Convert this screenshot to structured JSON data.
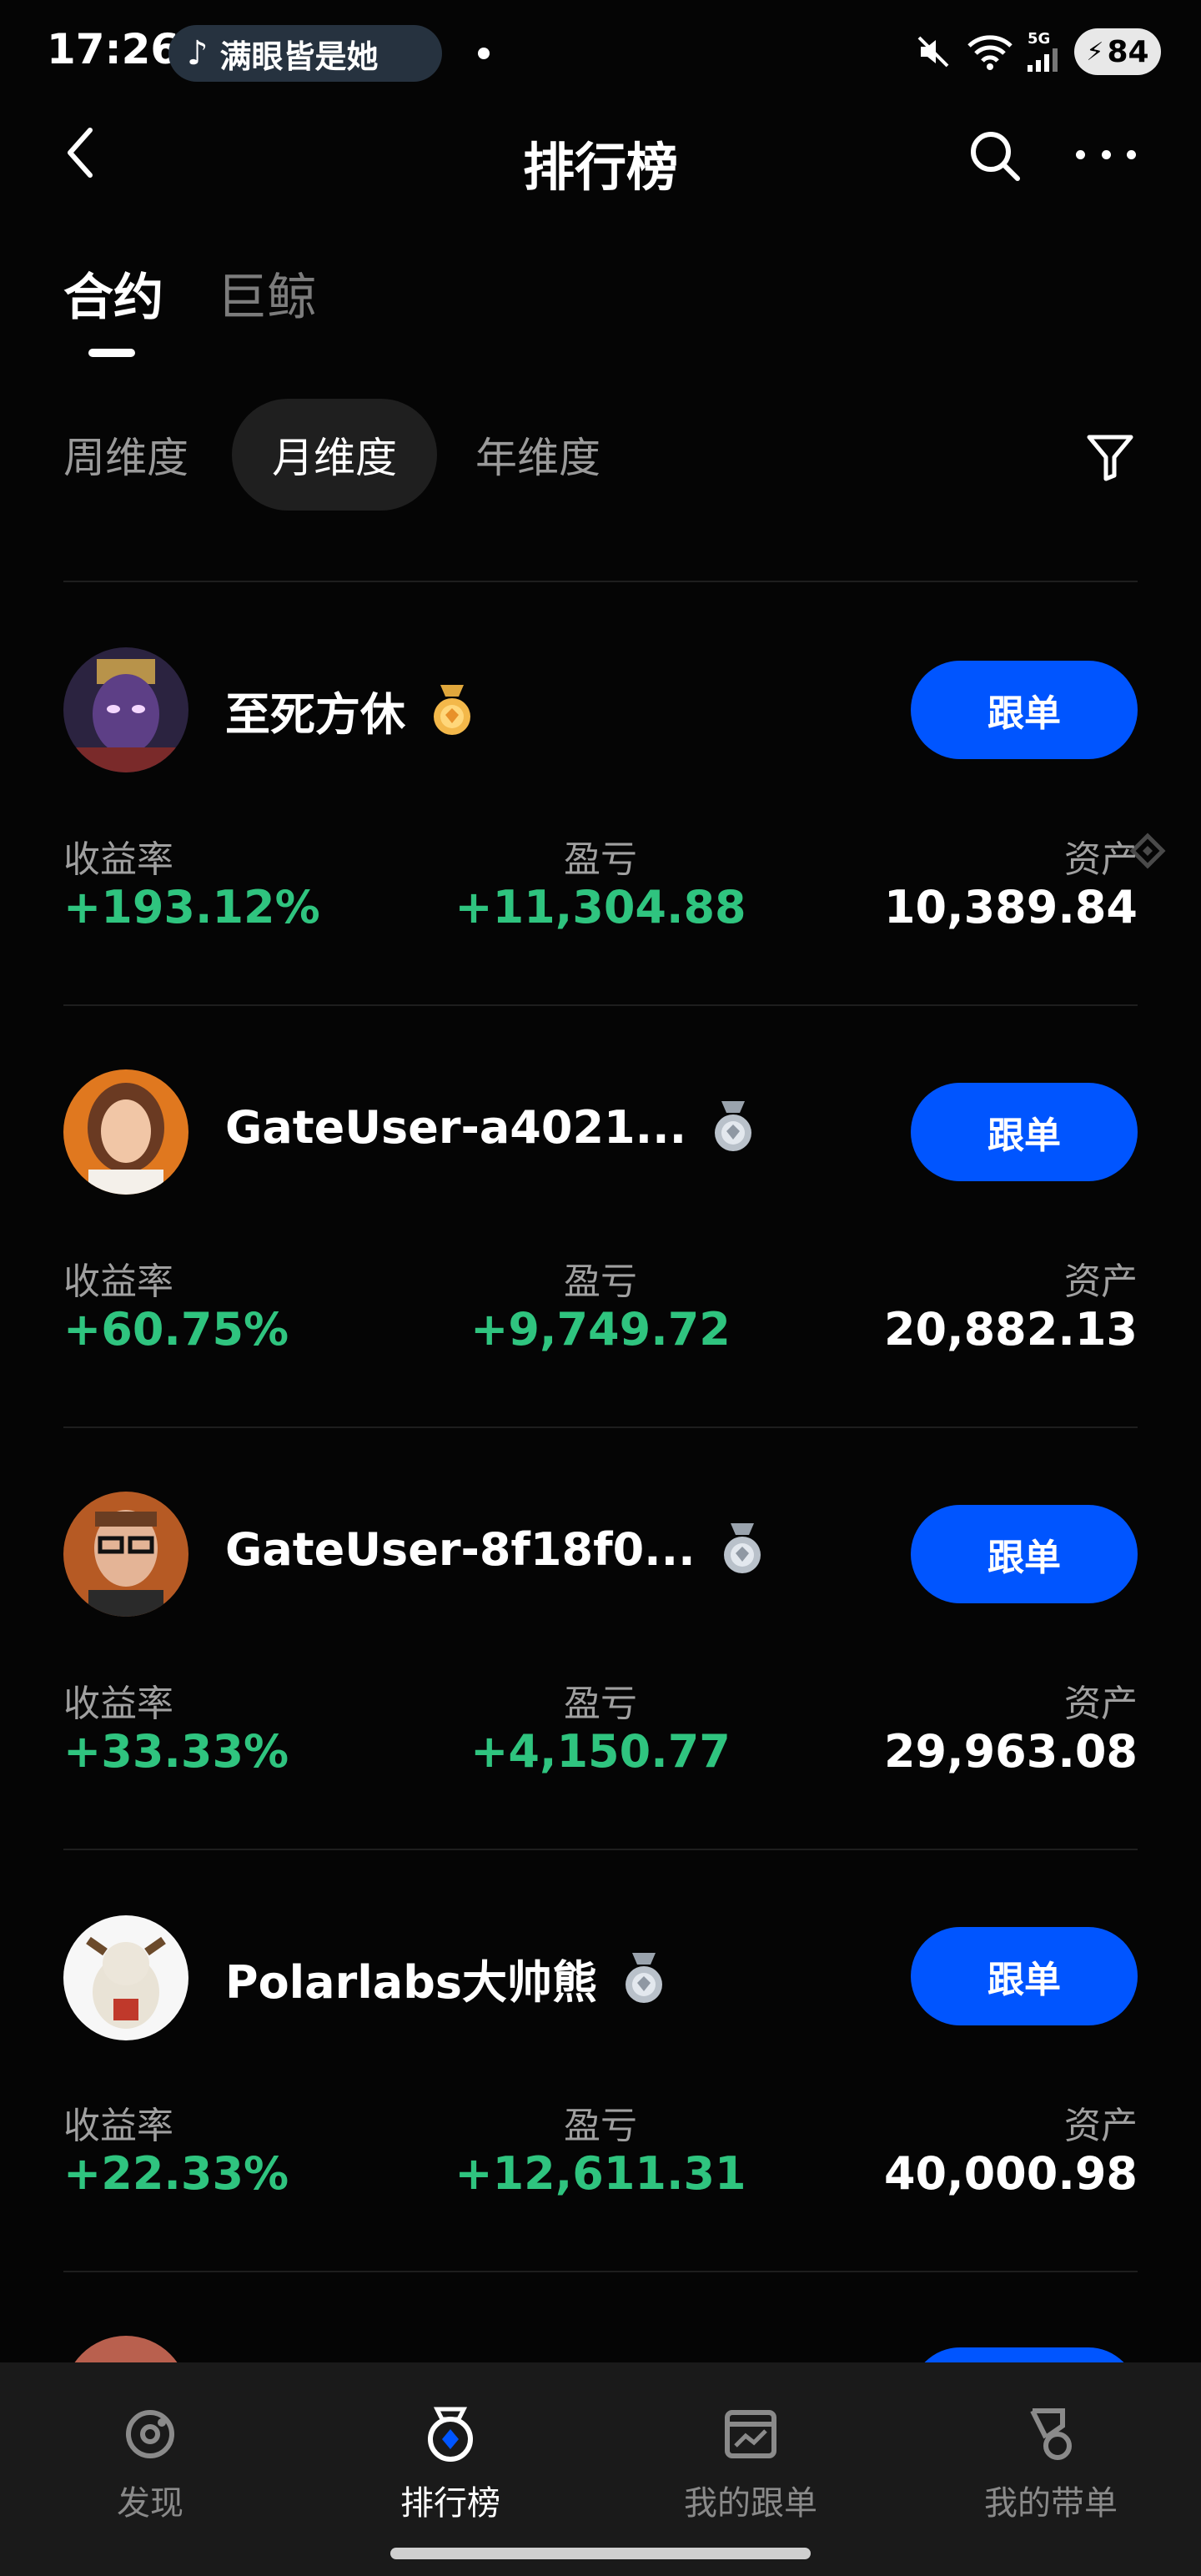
{
  "status_bar": {
    "time": "17:26",
    "tiktok_text": "满眼皆是她",
    "network": "5G",
    "battery": "84"
  },
  "header": {
    "title": "排行榜"
  },
  "main_tabs": [
    {
      "label": "合约",
      "active": true
    },
    {
      "label": "巨鲸",
      "active": false
    }
  ],
  "period_tabs": [
    {
      "label": "周维度",
      "active": false
    },
    {
      "label": "月维度",
      "active": true
    },
    {
      "label": "年维度",
      "active": false
    }
  ],
  "stat_labels": {
    "roi": "收益率",
    "pnl": "盈亏",
    "assets": "资产"
  },
  "follow_label": "跟单",
  "traders": [
    {
      "name": "至死方休",
      "roi": "+193.12%",
      "pnl": "+11,304.88",
      "assets": "10,389.84",
      "medal": "gold-medal-icon"
    },
    {
      "name": "GateUser-a4021...",
      "roi": "+60.75%",
      "pnl": "+9,749.72",
      "assets": "20,882.13",
      "medal": "silver-medal-icon"
    },
    {
      "name": "GateUser-8f18f0...",
      "roi": "+33.33%",
      "pnl": "+4,150.77",
      "assets": "29,963.08",
      "medal": "silver-medal-icon"
    },
    {
      "name": "Polarlabs大帅熊",
      "roi": "+22.33%",
      "pnl": "+12,611.31",
      "assets": "40,000.98",
      "medal": "silver-medal-icon"
    }
  ],
  "bottom_nav": [
    {
      "label": "发现",
      "icon": "discover-icon",
      "active": false
    },
    {
      "label": "排行榜",
      "icon": "leaderboard-icon",
      "active": true
    },
    {
      "label": "我的跟单",
      "icon": "my-copy-trades-icon",
      "active": false
    },
    {
      "label": "我的带单",
      "icon": "my-lead-trades-icon",
      "active": false
    }
  ],
  "colors": {
    "accent": "#0055ff",
    "positive": "#2fc47f",
    "background": "#050505"
  }
}
